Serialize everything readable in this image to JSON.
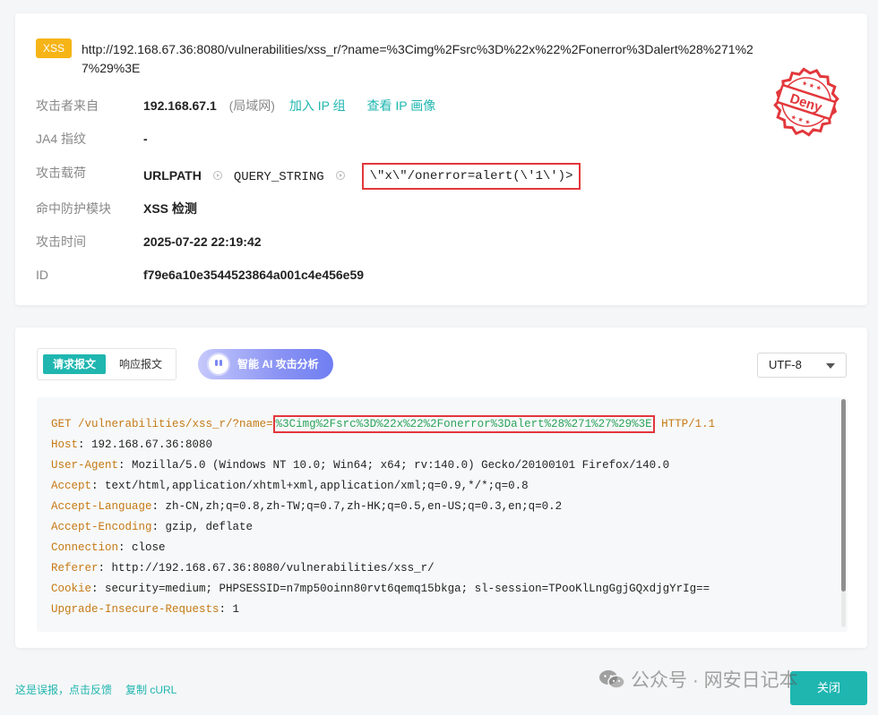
{
  "summary": {
    "badge": "XSS",
    "url": "http://192.168.67.36:8080/vulnerabilities/xss_r/?name=%3Cimg%2Fsrc%3D%22x%22%2Fonerror%3Dalert%28%271%27%29%3E",
    "stamp_text": "Deny",
    "colors": {
      "badge": "#f6b417",
      "accent": "#1fb6b0",
      "highlight": "#e2373b"
    }
  },
  "details": {
    "attacker": {
      "label": "攻击者来自",
      "ip": "192.168.67.1",
      "scope": "(局域网)",
      "add_group": "加入 IP 组",
      "view_profile": "查看 IP 画像"
    },
    "ja4": {
      "label": "JA4 指纹",
      "value": "-"
    },
    "payload": {
      "label": "攻击载荷",
      "part1": "URLPATH",
      "part2": "QUERY_STRING",
      "value": "\\\"x\\\"/onerror=alert(\\'1\\')>"
    },
    "module": {
      "label": "命中防护模块",
      "value": "XSS 检测"
    },
    "time": {
      "label": "攻击时间",
      "value": "2025-07-22 22:19:42"
    },
    "id": {
      "label": "ID",
      "value": "f79e6a10e3544523864a001c4e456e59"
    }
  },
  "request_panel": {
    "tabs": {
      "request": "请求报文",
      "response": "响应报文"
    },
    "ai_button": "智能 AI 攻击分析",
    "encoding": "UTF-8",
    "request_line": {
      "method": "GET",
      "path": "/vulnerabilities/xss_r/?name=",
      "query": "%3Cimg%2Fsrc%3D%22x%22%2Fonerror%3Dalert%28%271%27%29%3E",
      "protocol": "HTTP/1.1"
    },
    "headers": [
      {
        "name": "Host",
        "value": "192.168.67.36:8080"
      },
      {
        "name": "User-Agent",
        "value": "Mozilla/5.0 (Windows NT 10.0; Win64; x64; rv:140.0) Gecko/20100101 Firefox/140.0"
      },
      {
        "name": "Accept",
        "value": "text/html,application/xhtml+xml,application/xml;q=0.9,*/*;q=0.8"
      },
      {
        "name": "Accept-Language",
        "value": "zh-CN,zh;q=0.8,zh-TW;q=0.7,zh-HK;q=0.5,en-US;q=0.3,en;q=0.2"
      },
      {
        "name": "Accept-Encoding",
        "value": "gzip, deflate"
      },
      {
        "name": "Connection",
        "value": "close"
      },
      {
        "name": "Referer",
        "value": "http://192.168.67.36:8080/vulnerabilities/xss_r/"
      },
      {
        "name": "Cookie",
        "value": "security=medium; PHPSESSID=n7mp50oinn80rvt6qemq15bkga; sl-session=TPooKlLngGgjGQxdjgYrIg=="
      },
      {
        "name": "Upgrade-Insecure-Requests",
        "value": "1"
      }
    ]
  },
  "footer": {
    "feedback": "这是误报，点击反馈",
    "copy_curl": "复制 cURL",
    "close": "关闭",
    "watermark": "公众号 · 网安日记本"
  }
}
